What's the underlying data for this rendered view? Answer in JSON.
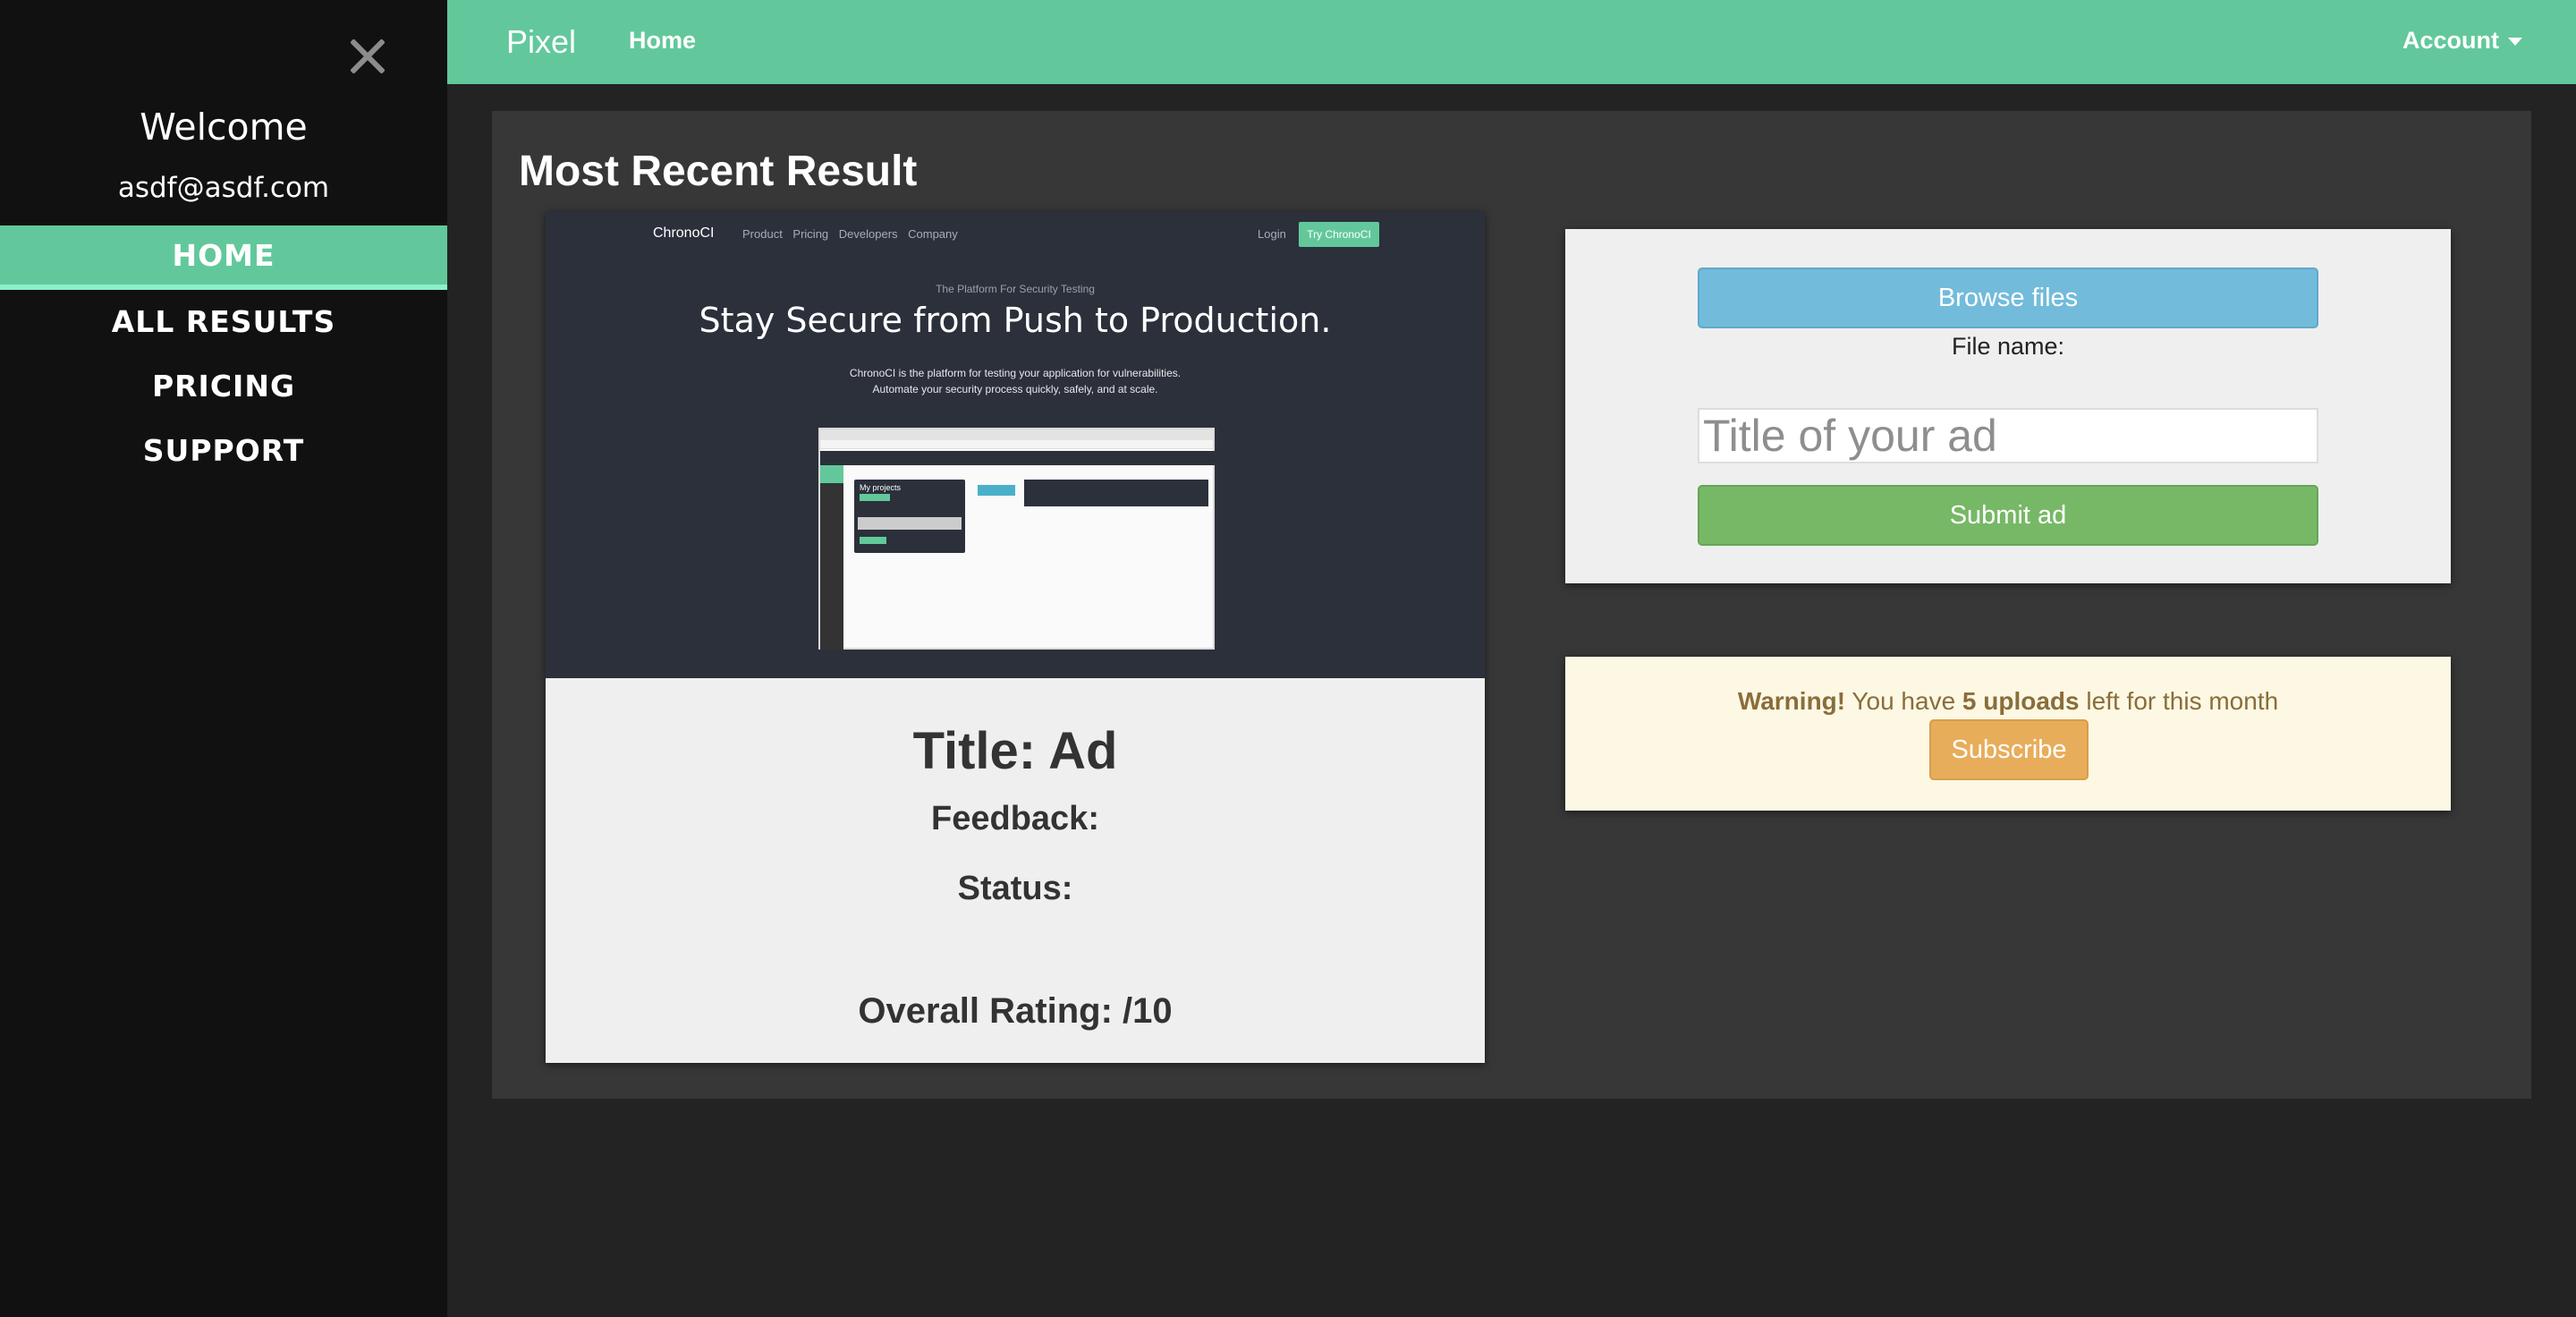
{
  "sidebar": {
    "close_icon": "close-icon",
    "welcome": "Welcome",
    "email": "asdf@asdf.com",
    "items": [
      {
        "label": "HOME",
        "active": true
      },
      {
        "label": "ALL RESULTS",
        "active": false
      },
      {
        "label": "PRICING",
        "active": false
      },
      {
        "label": "SUPPORT",
        "active": false
      }
    ]
  },
  "topbar": {
    "brand": "Pixel",
    "home": "Home",
    "account": "Account"
  },
  "main": {
    "title": "Most Recent Result",
    "result": {
      "screenshot": {
        "logo": "ChronoCI",
        "links": "Product Pricing Developers Company",
        "login": "Login",
        "try": "Try ChronoCI",
        "tagline": "The Platform For Security Testing",
        "headline": "Stay Secure from Push to Production.",
        "sub1": "ChronoCI is the platform for testing your application for vulnerabilities.",
        "sub2": "Automate your security process quickly, safely, and at scale.",
        "projects": "My projects"
      },
      "title": "Title: Ad",
      "feedback": "Feedback:",
      "status": "Status:",
      "rating": "Overall Rating: /10"
    },
    "upload": {
      "browse_label": "Browse files",
      "filename_label": "File name:",
      "title_placeholder": "Title of your ad",
      "submit_label": "Submit ad"
    },
    "warning": {
      "strong": "Warning!",
      "text1": "You have",
      "count": "5 uploads",
      "text2": "left for this month",
      "subscribe_label": "Subscribe"
    }
  },
  "colors": {
    "accent": "#62c89b",
    "sidebar_bg": "#111111",
    "browse": "#73bbdb",
    "submit": "#77b866",
    "subscribe": "#e8ad5a",
    "warning_bg": "#fcf8e3"
  }
}
